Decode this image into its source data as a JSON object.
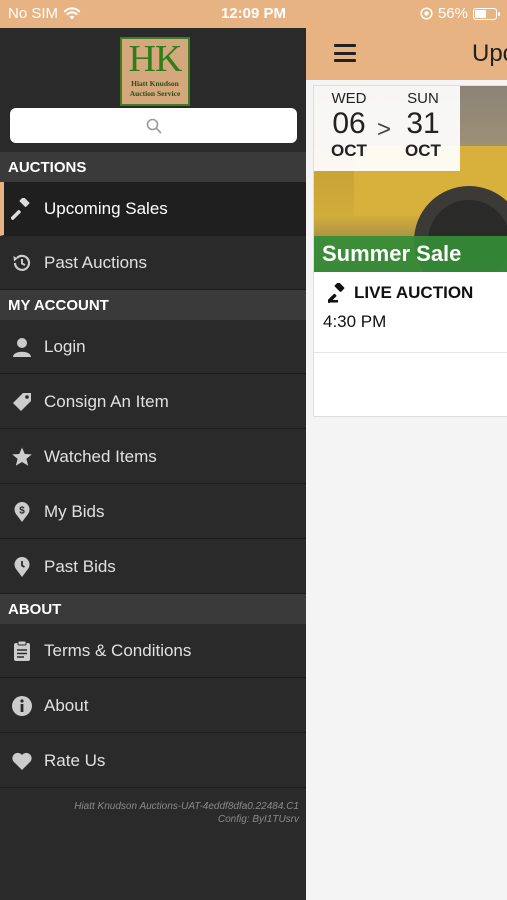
{
  "status_bar": {
    "carrier": "No SIM",
    "time": "12:09 PM",
    "battery_percent": "56%",
    "battery_level": 0.56
  },
  "app_header": {
    "title": "Upc"
  },
  "auction_card": {
    "start_dow": "WED",
    "start_day": "06",
    "start_month": "OCT",
    "separator": ">",
    "end_dow": "SUN",
    "end_day": "31",
    "end_month": "OCT",
    "sale_name": "Summer Sale",
    "auction_type": "LIVE AUCTION",
    "time": "4:30 PM"
  },
  "drawer": {
    "logo": {
      "initials": "HK",
      "line1": "Hiatt Knudson",
      "line2": "Auction Service"
    },
    "search": {
      "placeholder": ""
    },
    "sections": {
      "auctions": "AUCTIONS",
      "my_account": "MY ACCOUNT",
      "about": "ABOUT"
    },
    "items": {
      "upcoming_sales": "Upcoming Sales",
      "past_auctions": "Past Auctions",
      "login": "Login",
      "consign": "Consign An Item",
      "watched": "Watched Items",
      "my_bids": "My Bids",
      "past_bids": "Past Bids",
      "terms": "Terms & Conditions",
      "about": "About",
      "rate_us": "Rate Us"
    },
    "footer": {
      "line1": "Hiatt Knudson Auctions-UAT-4eddf8dfa0.22484.C1",
      "line2": "Config: ByI1TUsrv"
    }
  },
  "colors": {
    "accent": "#e8b383",
    "drawer_bg": "#2a2a2a",
    "section_bg": "#3a3a3a",
    "sale_band": "#348c36"
  }
}
